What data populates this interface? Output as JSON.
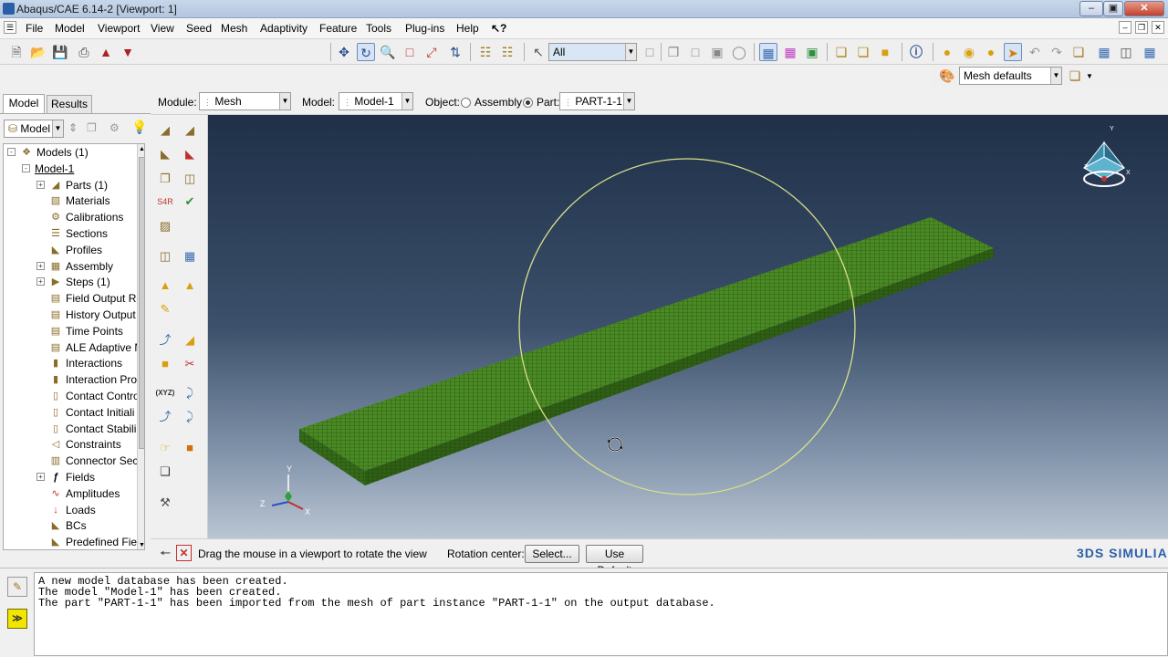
{
  "window": {
    "title": "Abaqus/CAE 6.14-2 [Viewport: 1]"
  },
  "menu": [
    "File",
    "Model",
    "Viewport",
    "View",
    "Seed",
    "Mesh",
    "Adaptivity",
    "Feature",
    "Tools",
    "Plug-ins",
    "Help"
  ],
  "toolbar": {
    "selection_filter": "All",
    "mesh_defaults": "Mesh defaults"
  },
  "context": {
    "module_label": "Module:",
    "module_value": "Mesh",
    "model_label": "Model:",
    "model_value": "Model-1",
    "object_label": "Object:",
    "assembly_label": "Assembly",
    "part_label": "Part:",
    "part_value": "PART-1-1",
    "object_selected": "Part"
  },
  "left_panel": {
    "tabs": [
      "Model",
      "Results"
    ],
    "active_tab": "Model",
    "tree_filter": "Model",
    "tree": [
      {
        "label": "Models (1)",
        "level": 0,
        "expander": "-",
        "icon": "models-icon"
      },
      {
        "label": "Model-1",
        "level": 1,
        "expander": "-",
        "icon": ""
      },
      {
        "label": "Parts (1)",
        "level": 2,
        "expander": "+",
        "icon": "parts-icon"
      },
      {
        "label": "Materials",
        "level": 2,
        "expander": "",
        "icon": "materials-icon"
      },
      {
        "label": "Calibrations",
        "level": 2,
        "expander": "",
        "icon": "calibrations-icon"
      },
      {
        "label": "Sections",
        "level": 2,
        "expander": "",
        "icon": "sections-icon"
      },
      {
        "label": "Profiles",
        "level": 2,
        "expander": "",
        "icon": "profiles-icon"
      },
      {
        "label": "Assembly",
        "level": 2,
        "expander": "+",
        "icon": "assembly-icon"
      },
      {
        "label": "Steps (1)",
        "level": 2,
        "expander": "+",
        "icon": "steps-icon"
      },
      {
        "label": "Field Output Re",
        "level": 2,
        "expander": "",
        "icon": "field-output-icon"
      },
      {
        "label": "History Output",
        "level": 2,
        "expander": "",
        "icon": "history-output-icon"
      },
      {
        "label": "Time Points",
        "level": 2,
        "expander": "",
        "icon": "time-points-icon"
      },
      {
        "label": "ALE Adaptive M",
        "level": 2,
        "expander": "",
        "icon": "ale-icon"
      },
      {
        "label": "Interactions",
        "level": 2,
        "expander": "",
        "icon": "interactions-icon"
      },
      {
        "label": "Interaction Pro",
        "level": 2,
        "expander": "",
        "icon": "interaction-properties-icon"
      },
      {
        "label": "Contact Contro",
        "level": 2,
        "expander": "",
        "icon": "contact-controls-icon"
      },
      {
        "label": "Contact Initiali",
        "level": 2,
        "expander": "",
        "icon": "contact-init-icon"
      },
      {
        "label": "Contact Stabili",
        "level": 2,
        "expander": "",
        "icon": "contact-stab-icon"
      },
      {
        "label": "Constraints",
        "level": 2,
        "expander": "",
        "icon": "constraints-icon"
      },
      {
        "label": "Connector Sec",
        "level": 2,
        "expander": "",
        "icon": "connector-icon"
      },
      {
        "label": "Fields",
        "level": 2,
        "expander": "+",
        "icon": "fields-icon"
      },
      {
        "label": "Amplitudes",
        "level": 2,
        "expander": "",
        "icon": "amplitudes-icon"
      },
      {
        "label": "Loads",
        "level": 2,
        "expander": "",
        "icon": "loads-icon"
      },
      {
        "label": "BCs",
        "level": 2,
        "expander": "",
        "icon": "bcs-icon"
      },
      {
        "label": "Predefined Fiel",
        "level": 2,
        "expander": "",
        "icon": "predefined-icon"
      }
    ]
  },
  "viewport": {
    "triad_labels": {
      "x": "X",
      "y": "Y",
      "z": "Z"
    },
    "mesh_color": "#3f7a1e",
    "rotation_circle_color": "#d8e08a",
    "background_top": "#1f3048",
    "background_bottom": "#b9c5d3"
  },
  "prompt": {
    "text": "Drag the mouse in a viewport to rotate the view",
    "rotation_center_label": "Rotation center:",
    "select_button": "Select...",
    "use_default_button": "Use Default"
  },
  "brand": "3DS SIMULIA",
  "messages": [
    "A new model database has been created.",
    "The model \"Model-1\" has been created.",
    "The part \"PART-1-1\" has been imported from the mesh of part instance \"PART-1-1\" on the output database."
  ]
}
